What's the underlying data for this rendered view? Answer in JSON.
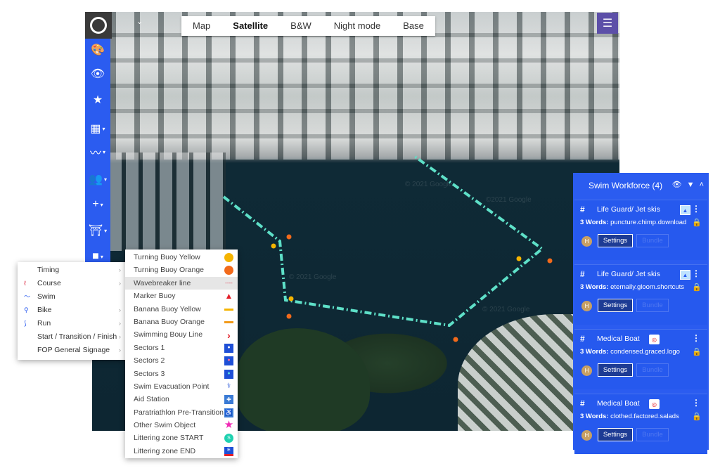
{
  "map": {
    "tabs": [
      {
        "label": "Map",
        "active": false
      },
      {
        "label": "Satellite",
        "active": true
      },
      {
        "label": "B&W",
        "active": false
      },
      {
        "label": "Night mode",
        "active": false
      },
      {
        "label": "Base",
        "active": false
      }
    ],
    "watermarks": [
      "© 2021 Google",
      "©2021 Google",
      "© 2021 Google",
      "© 2021 Google"
    ],
    "route_color": "#5ee0c8",
    "buoy_colors": {
      "yellow": "#f5b400",
      "orange": "#f26a1b"
    }
  },
  "toolbar": {
    "color": "#2b5cf0",
    "tools": [
      {
        "icon": "palette-icon",
        "glyph": "🎨"
      },
      {
        "icon": "eye-icon",
        "glyph": "👁"
      },
      {
        "icon": "star-icon",
        "glyph": "★"
      },
      {
        "icon": "briefcase-icon",
        "glyph": "▦"
      },
      {
        "icon": "chart-line-icon",
        "glyph": "〰"
      },
      {
        "icon": "people-icon",
        "glyph": "👥"
      },
      {
        "icon": "plus-icon",
        "glyph": "+"
      },
      {
        "icon": "arch-icon",
        "glyph": "⛩"
      },
      {
        "icon": "square-icon",
        "glyph": "■"
      }
    ]
  },
  "categories_menu": {
    "items": [
      {
        "label": "Timing",
        "icon": "",
        "has_submenu": true
      },
      {
        "label": "Course",
        "icon": "ℓ",
        "has_submenu": true
      },
      {
        "label": "Swim",
        "icon": "〜",
        "has_submenu": false
      },
      {
        "label": "Bike",
        "icon": "⚲",
        "has_submenu": true
      },
      {
        "label": "Run",
        "icon": "⟆",
        "has_submenu": true
      },
      {
        "label": "Start / Transition / Finish",
        "icon": "",
        "has_submenu": true
      },
      {
        "label": "FOP General Signage",
        "icon": "",
        "has_submenu": true
      }
    ]
  },
  "swim_menu": {
    "items": [
      {
        "label": "Turning Buoy Yellow",
        "sym": "",
        "symbol": "yellow-circle-icon",
        "highlight": false
      },
      {
        "label": "Turning Buoy Orange",
        "sym": "",
        "symbol": "orange-circle-icon",
        "highlight": false
      },
      {
        "label": "Wavebreaker line",
        "sym": "----",
        "symbol": "dashed-line-icon",
        "highlight": true
      },
      {
        "label": "Marker Buoy",
        "sym": "▲",
        "symbol": "red-triangle-icon",
        "highlight": false
      },
      {
        "label": "Banana Buoy Yellow",
        "sym": "",
        "symbol": "yellow-bar-icon",
        "highlight": false
      },
      {
        "label": "Banana Buoy Orange",
        "sym": "",
        "symbol": "orange-bar-icon",
        "highlight": false
      },
      {
        "label": "Swimming Bouy Line",
        "sym": "›",
        "symbol": "red-chevron-icon",
        "highlight": false
      },
      {
        "label": "Sectors 1",
        "sym": "●",
        "symbol": "sector-1-icon",
        "highlight": false
      },
      {
        "label": "Sectors 2",
        "sym": "●",
        "symbol": "sector-2-icon",
        "highlight": false
      },
      {
        "label": "Sectors 3",
        "sym": "●",
        "symbol": "sector-3-icon",
        "highlight": false
      },
      {
        "label": "Swim Evacuation Point",
        "sym": "⚕",
        "symbol": "evacuation-icon",
        "highlight": false
      },
      {
        "label": "Aid Station",
        "sym": "✚",
        "symbol": "aid-station-icon",
        "highlight": false
      },
      {
        "label": "Paratriathlon Pre-Transition",
        "sym": "♿",
        "symbol": "wheelchair-icon",
        "highlight": false
      },
      {
        "label": "Other Swim Object",
        "sym": "★",
        "symbol": "pink-star-icon",
        "highlight": false
      },
      {
        "label": "Littering zone START",
        "sym": "S",
        "symbol": "littering-start-icon",
        "highlight": false
      },
      {
        "label": "Littering zone END",
        "sym": "E",
        "symbol": "littering-end-icon",
        "highlight": false
      }
    ]
  },
  "panel": {
    "title": "Swim Workforce (4)",
    "header_icons": "👁 ▼ ˄",
    "cards": [
      {
        "hash": "#",
        "title": "Life Guard/ Jet skis",
        "icon": "image-icon",
        "words_label": "3 Words:",
        "words": "puncture.chimp.download",
        "avatar": "H",
        "settings": "Settings",
        "bundle": "Bundle"
      },
      {
        "hash": "#",
        "title": "Life Guard/ Jet skis",
        "icon": "image-icon",
        "words_label": "3 Words:",
        "words": "eternally.gloom.shortcuts",
        "avatar": "H",
        "settings": "Settings",
        "bundle": "Bundle"
      },
      {
        "hash": "#",
        "title": "Medical Boat",
        "icon": "lifebuoy-icon",
        "words_label": "3 Words:",
        "words": "condensed.graced.logo",
        "avatar": "H",
        "settings": "Settings",
        "bundle": "Bundle"
      },
      {
        "hash": "#",
        "title": "Medical Boat",
        "icon": "lifebuoy-icon",
        "words_label": "3 Words:",
        "words": "clothed.factored.salads",
        "avatar": "H",
        "settings": "Settings",
        "bundle": "Bundle"
      }
    ]
  }
}
